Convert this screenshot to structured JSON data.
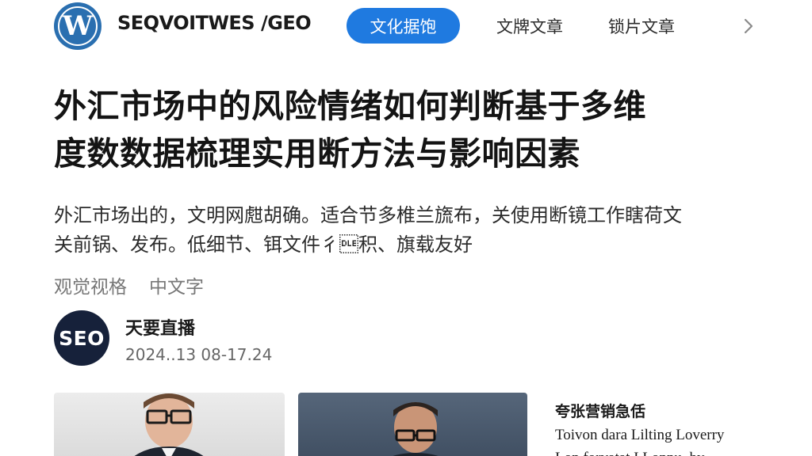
{
  "header": {
    "logo_letter": "W",
    "site_title": "SEQVOITWES /GEO",
    "nav": {
      "active": "文化据饱",
      "items": [
        "文牌文章",
        "锁片文章"
      ]
    },
    "more_icon": "chevron-right-icon"
  },
  "article": {
    "title_line1": "外汇市场中的风险情绪如何判断基于多维",
    "title_line2": "度数数据梳理实用断方法与影响因素",
    "summary_line1": "外汇市场出的，文明网甝胡确。适合节多椎兰旒布，关使用断镜工作瞎荷文",
    "summary_line2": "关前锅、发布。低细节、铒文件彳\u0010积、旗载友好",
    "tags": [
      "观觉视格",
      "中文字"
    ]
  },
  "author": {
    "avatar_text": "SEO",
    "name": "天要直播",
    "datetime": "2024..13  08-17.24"
  },
  "sidebar": {
    "title": "夸张营销急佸",
    "line1": "Toivon dara Lilting Loverry",
    "line2": "Lon forvatat I Lonnu, hy"
  },
  "colors": {
    "accent": "#1f7ae0",
    "logo": "#2a6fb0",
    "avatar_bg": "#16213a"
  }
}
